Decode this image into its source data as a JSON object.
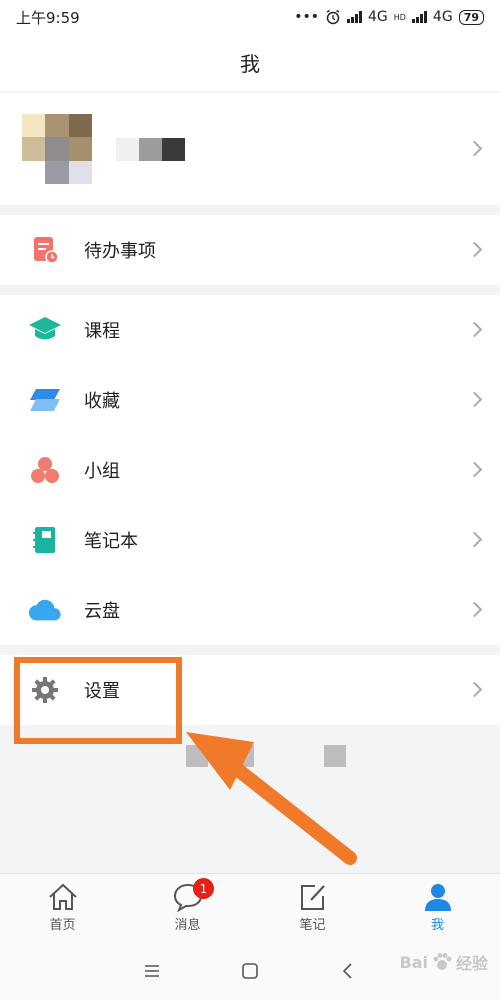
{
  "status_bar": {
    "time": "上午9:59",
    "dots": "•••",
    "net1": "4G",
    "net2_tag": "HD",
    "net2": "4G",
    "battery": "79"
  },
  "header": {
    "title": "我"
  },
  "menu": {
    "todo": "待办事项",
    "courses": "课程",
    "favorites": "收藏",
    "groups": "小组",
    "notebook": "笔记本",
    "cloud": "云盘",
    "settings": "设置"
  },
  "tabs": {
    "home": "首页",
    "messages": "消息",
    "messages_badge": "1",
    "notes": "笔记",
    "me": "我"
  },
  "watermark": {
    "text": "Bai",
    "suffix": "经验"
  },
  "colors": {
    "accent": "#1e88e5",
    "highlight": "#f07a2a",
    "badge": "#e62117",
    "todo_icon": "#f2736b",
    "course_icon": "#1bb99a",
    "favorite_icon": "#2c8be8",
    "group_icon": "#f07b6e",
    "notebook_icon": "#19b5a0",
    "cloud_icon": "#39a7f0",
    "settings_icon": "#777777"
  }
}
